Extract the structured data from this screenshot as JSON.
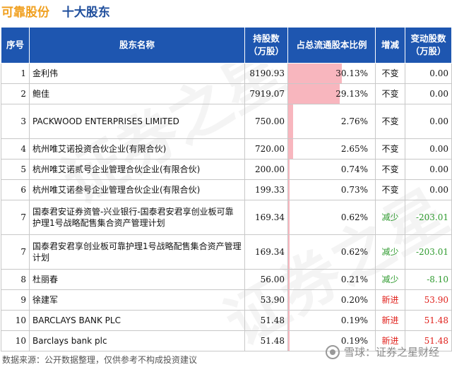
{
  "header": {
    "company": "可靠股份",
    "section": "十大股东"
  },
  "columns": {
    "idx": "序号",
    "name": "股东名称",
    "held": "持股数\n（万股）",
    "pct": "占总流通股本比例",
    "chg": "增减",
    "delta": "变动股数\n（万股）"
  },
  "rows": [
    {
      "idx": "1",
      "name": "金利伟",
      "held": "8190.93",
      "pct": "30.13%",
      "pct_value": 30.13,
      "chg": "不变",
      "delta": "0.00",
      "status": "same"
    },
    {
      "idx": "2",
      "name": "鲍佳",
      "held": "7919.07",
      "pct": "29.13%",
      "pct_value": 29.13,
      "chg": "不变",
      "delta": "0.00",
      "status": "same"
    },
    {
      "idx": "3",
      "name": "PACKWOOD ENTERPRISES LIMITED",
      "held": "750.00",
      "pct": "2.76%",
      "pct_value": 2.76,
      "chg": "不变",
      "delta": "0.00",
      "status": "same"
    },
    {
      "idx": "4",
      "name": "杭州唯艾诺投资合伙企业(有限合伙)",
      "held": "720.00",
      "pct": "2.65%",
      "pct_value": 2.65,
      "chg": "不变",
      "delta": "0.00",
      "status": "same"
    },
    {
      "idx": "5",
      "name": "杭州唯艾诺贰号企业管理合伙企业(有限合伙)",
      "held": "200.00",
      "pct": "0.74%",
      "pct_value": 0.74,
      "chg": "不变",
      "delta": "0.00",
      "status": "same"
    },
    {
      "idx": "6",
      "name": "杭州唯艾诺叁号企业管理合伙企业(有限合伙)",
      "held": "199.33",
      "pct": "0.73%",
      "pct_value": 0.73,
      "chg": "不变",
      "delta": "0.00",
      "status": "same"
    },
    {
      "idx": "7",
      "name": "国泰君安证券资管-兴业银行-国泰君安君享创业板可靠护理1号战略配售集合资产管理计划",
      "held": "169.34",
      "pct": "0.62%",
      "pct_value": 0.62,
      "chg": "减少",
      "delta": "-203.01",
      "status": "down"
    },
    {
      "idx": "7",
      "name": "国泰君安君享创业板可靠护理1号战略配售集合资产管理计划",
      "held": "169.34",
      "pct": "0.62%",
      "pct_value": 0.62,
      "chg": "减少",
      "delta": "-203.01",
      "status": "down"
    },
    {
      "idx": "8",
      "name": "杜丽春",
      "held": "56.00",
      "pct": "0.21%",
      "pct_value": 0.21,
      "chg": "减少",
      "delta": "-8.10",
      "status": "down"
    },
    {
      "idx": "9",
      "name": "徐建军",
      "held": "53.90",
      "pct": "0.20%",
      "pct_value": 0.2,
      "chg": "新进",
      "delta": "53.90",
      "status": "new"
    },
    {
      "idx": "10",
      "name": "BARCLAYS BANK PLC",
      "held": "51.48",
      "pct": "0.19%",
      "pct_value": 0.19,
      "chg": "新进",
      "delta": "51.48",
      "status": "new"
    },
    {
      "idx": "10",
      "name": "Barclays bank plc",
      "held": "51.48",
      "pct": "0.19%",
      "pct_value": 0.19,
      "chg": "新进",
      "delta": "51.48",
      "status": "new"
    }
  ],
  "footer": {
    "source": "数据来源：公开数据整理，仅供参考不构成投资建议"
  },
  "brand": {
    "text": "雪球：证券之星财经",
    "logo_icon": "snowball-logo-icon"
  },
  "watermark": {
    "text": "证券之星"
  },
  "colors": {
    "header_bg": "#1e56b0",
    "bar": "#f8b6be",
    "up": "#e0201b",
    "down": "#2e9a2e",
    "company": "#f0a020",
    "section": "#1f4e9c"
  }
}
